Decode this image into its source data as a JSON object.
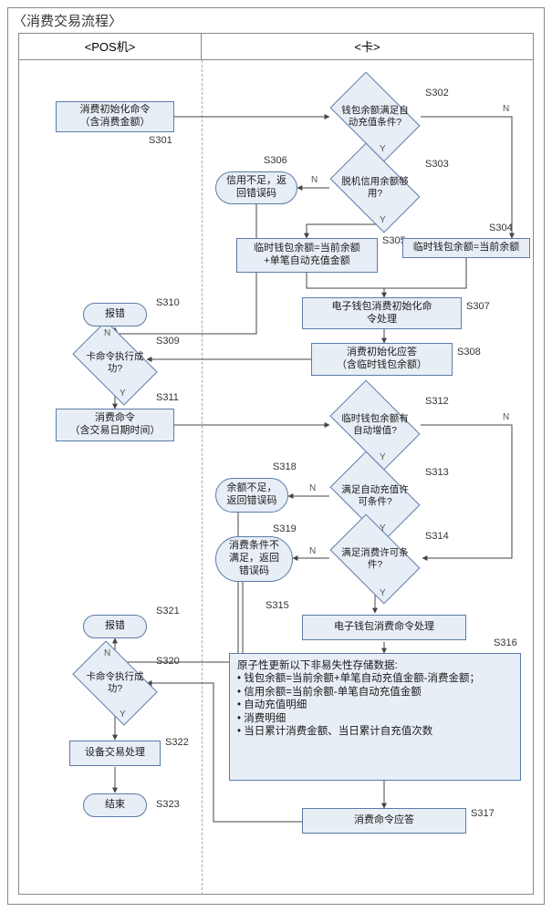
{
  "title": "〈消费交易流程〉",
  "lanes": {
    "pos": "<POS机>",
    "card": "<卡>"
  },
  "edge_labels": {
    "yes": "Y",
    "no": "N"
  },
  "nodes": {
    "s301": {
      "id": "S301",
      "text": "消费初始化命令\n（含消费金额）"
    },
    "s302": {
      "id": "S302",
      "text": "钱包余额满足自\n动充值条件?"
    },
    "s303": {
      "id": "S303",
      "text": "脱机信用余额够\n用?"
    },
    "s304": {
      "id": "S304",
      "text": "临时钱包余额=当前余额"
    },
    "s305": {
      "id": "S305",
      "text": "临时钱包余额=当前余额\n+单笔自动充值金额"
    },
    "s306": {
      "id": "S306",
      "text": "信用不足，返\n回错误码"
    },
    "s307": {
      "id": "S307",
      "text": "电子钱包消费初始化命\n令处理"
    },
    "s308": {
      "id": "S308",
      "text": "消费初始化应答\n（含临时钱包余额）"
    },
    "s309": {
      "id": "S309",
      "text": "卡命令执行成\n功?"
    },
    "s310": {
      "id": "S310",
      "text": "报错"
    },
    "s311": {
      "id": "S311",
      "text": "消费命令\n（含交易日期时间）"
    },
    "s312": {
      "id": "S312",
      "text": "临时钱包余额有\n自动增值?"
    },
    "s313": {
      "id": "S313",
      "text": "满足自动充值许\n可条件?"
    },
    "s314": {
      "id": "S314",
      "text": "满足消费许可条\n件?"
    },
    "s315": {
      "id": "S315",
      "text": "电子钱包消费命令处理"
    },
    "s316": {
      "id": "S316",
      "text": "原子性更新以下非易失性存储数据:\n• 钱包余额=当前余额+单笔自动充值金额-消费金额；\n• 信用余额=当前余额-单笔自动充值金额\n• 自动充值明细\n• 消费明细\n• 当日累计消费金额、当日累计自充值次数"
    },
    "s317": {
      "id": "S317",
      "text": "消费命令应答"
    },
    "s318": {
      "id": "S318",
      "text": "余额不足，\n返回错误码"
    },
    "s319": {
      "id": "S319",
      "text": "消费条件不\n满足，返回\n错误码"
    },
    "s320": {
      "id": "S320",
      "text": "卡命令执行成\n功?"
    },
    "s321": {
      "id": "S321",
      "text": "报错"
    },
    "s322": {
      "id": "S322",
      "text": "设备交易处理"
    },
    "s323": {
      "id": "S323",
      "text": "结束"
    }
  },
  "chart_data": {
    "type": "flowchart",
    "title": "消费交易流程",
    "swimlanes": [
      "POS机",
      "卡"
    ],
    "nodes": [
      {
        "id": "S301",
        "lane": "POS机",
        "type": "process",
        "label": "消费初始化命令（含消费金额）"
      },
      {
        "id": "S302",
        "lane": "卡",
        "type": "decision",
        "label": "钱包余额满足自动充值条件?"
      },
      {
        "id": "S303",
        "lane": "卡",
        "type": "decision",
        "label": "脱机信用余额够用?"
      },
      {
        "id": "S304",
        "lane": "卡",
        "type": "process",
        "label": "临时钱包余额=当前余额"
      },
      {
        "id": "S305",
        "lane": "卡",
        "type": "process",
        "label": "临时钱包余额=当前余额+单笔自动充值金额"
      },
      {
        "id": "S306",
        "lane": "卡",
        "type": "terminator",
        "label": "信用不足，返回错误码"
      },
      {
        "id": "S307",
        "lane": "卡",
        "type": "process",
        "label": "电子钱包消费初始化命令处理"
      },
      {
        "id": "S308",
        "lane": "卡",
        "type": "process",
        "label": "消费初始化应答（含临时钱包余额）"
      },
      {
        "id": "S309",
        "lane": "POS机",
        "type": "decision",
        "label": "卡命令执行成功?"
      },
      {
        "id": "S310",
        "lane": "POS机",
        "type": "terminator",
        "label": "报错"
      },
      {
        "id": "S311",
        "lane": "POS机",
        "type": "process",
        "label": "消费命令（含交易日期时间）"
      },
      {
        "id": "S312",
        "lane": "卡",
        "type": "decision",
        "label": "临时钱包余额有自动增值?"
      },
      {
        "id": "S313",
        "lane": "卡",
        "type": "decision",
        "label": "满足自动充值许可条件?"
      },
      {
        "id": "S314",
        "lane": "卡",
        "type": "decision",
        "label": "满足消费许可条件?"
      },
      {
        "id": "S315",
        "lane": "卡",
        "type": "process",
        "label": "电子钱包消费命令处理"
      },
      {
        "id": "S316",
        "lane": "卡",
        "type": "process",
        "label": "原子性更新以下非易失性存储数据: 钱包余额=当前余额+单笔自动充值金额-消费金额；信用余额=当前余额-单笔自动充值金额；自动充值明细；消费明细；当日累计消费金额、当日累计自充值次数"
      },
      {
        "id": "S317",
        "lane": "卡",
        "type": "process",
        "label": "消费命令应答"
      },
      {
        "id": "S318",
        "lane": "卡",
        "type": "terminator",
        "label": "余额不足，返回错误码"
      },
      {
        "id": "S319",
        "lane": "卡",
        "type": "terminator",
        "label": "消费条件不满足，返回错误码"
      },
      {
        "id": "S320",
        "lane": "POS机",
        "type": "decision",
        "label": "卡命令执行成功?"
      },
      {
        "id": "S321",
        "lane": "POS机",
        "type": "terminator",
        "label": "报错"
      },
      {
        "id": "S322",
        "lane": "POS机",
        "type": "process",
        "label": "设备交易处理"
      },
      {
        "id": "S323",
        "lane": "POS机",
        "type": "terminator",
        "label": "结束"
      }
    ],
    "edges": [
      {
        "from": "S301",
        "to": "S302"
      },
      {
        "from": "S302",
        "to": "S303",
        "label": "Y"
      },
      {
        "from": "S302",
        "to": "S304",
        "label": "N"
      },
      {
        "from": "S303",
        "to": "S305",
        "label": "Y"
      },
      {
        "from": "S303",
        "to": "S306",
        "label": "N"
      },
      {
        "from": "S305",
        "to": "S307"
      },
      {
        "from": "S304",
        "to": "S307"
      },
      {
        "from": "S307",
        "to": "S308"
      },
      {
        "from": "S308",
        "to": "S309"
      },
      {
        "from": "S306",
        "to": "S309"
      },
      {
        "from": "S309",
        "to": "S310",
        "label": "N"
      },
      {
        "from": "S309",
        "to": "S311",
        "label": "Y"
      },
      {
        "from": "S311",
        "to": "S312"
      },
      {
        "from": "S312",
        "to": "S313",
        "label": "Y"
      },
      {
        "from": "S312",
        "to": "S314",
        "label": "N"
      },
      {
        "from": "S313",
        "to": "S314",
        "label": "Y"
      },
      {
        "from": "S313",
        "to": "S318",
        "label": "N"
      },
      {
        "from": "S314",
        "to": "S315",
        "label": "Y"
      },
      {
        "from": "S314",
        "to": "S319",
        "label": "N"
      },
      {
        "from": "S315",
        "to": "S316"
      },
      {
        "from": "S316",
        "to": "S317"
      },
      {
        "from": "S317",
        "to": "S320"
      },
      {
        "from": "S318",
        "to": "S320"
      },
      {
        "from": "S319",
        "to": "S320"
      },
      {
        "from": "S320",
        "to": "S321",
        "label": "N"
      },
      {
        "from": "S320",
        "to": "S322",
        "label": "Y"
      },
      {
        "from": "S322",
        "to": "S323"
      }
    ]
  }
}
